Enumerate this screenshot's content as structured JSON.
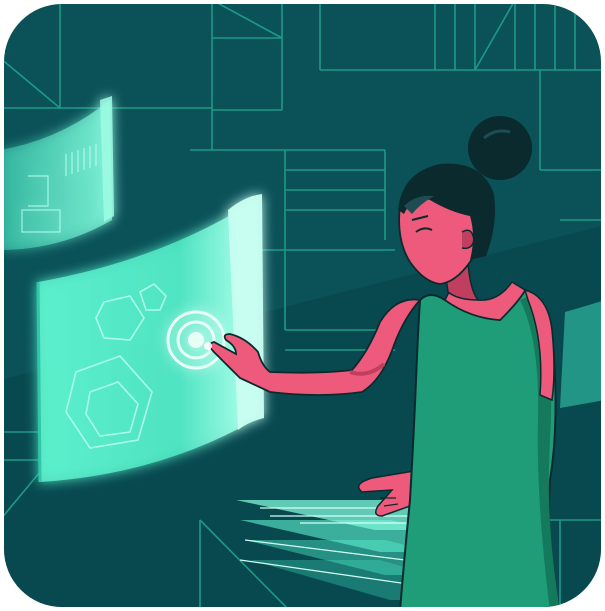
{
  "illustration": {
    "subject": "woman-touching-holographic-interface",
    "colors": {
      "frame": "#ffffff",
      "background": "#0a5158",
      "background_dark": "#07444a",
      "circuit_lines": "#1c9a86",
      "hologram": "#5ef3cf",
      "hologram_edge": "#bafff0",
      "skin": "#ee5a7b",
      "skin_shadow": "#c03e5f",
      "dress": "#1f9c78",
      "dress_shadow": "#157a5c",
      "hair": "#0b2a2e",
      "outline": "#0b2a2e"
    },
    "icons": [
      "target-rings-icon",
      "hexagon-icon",
      "pentagon-icon"
    ]
  }
}
